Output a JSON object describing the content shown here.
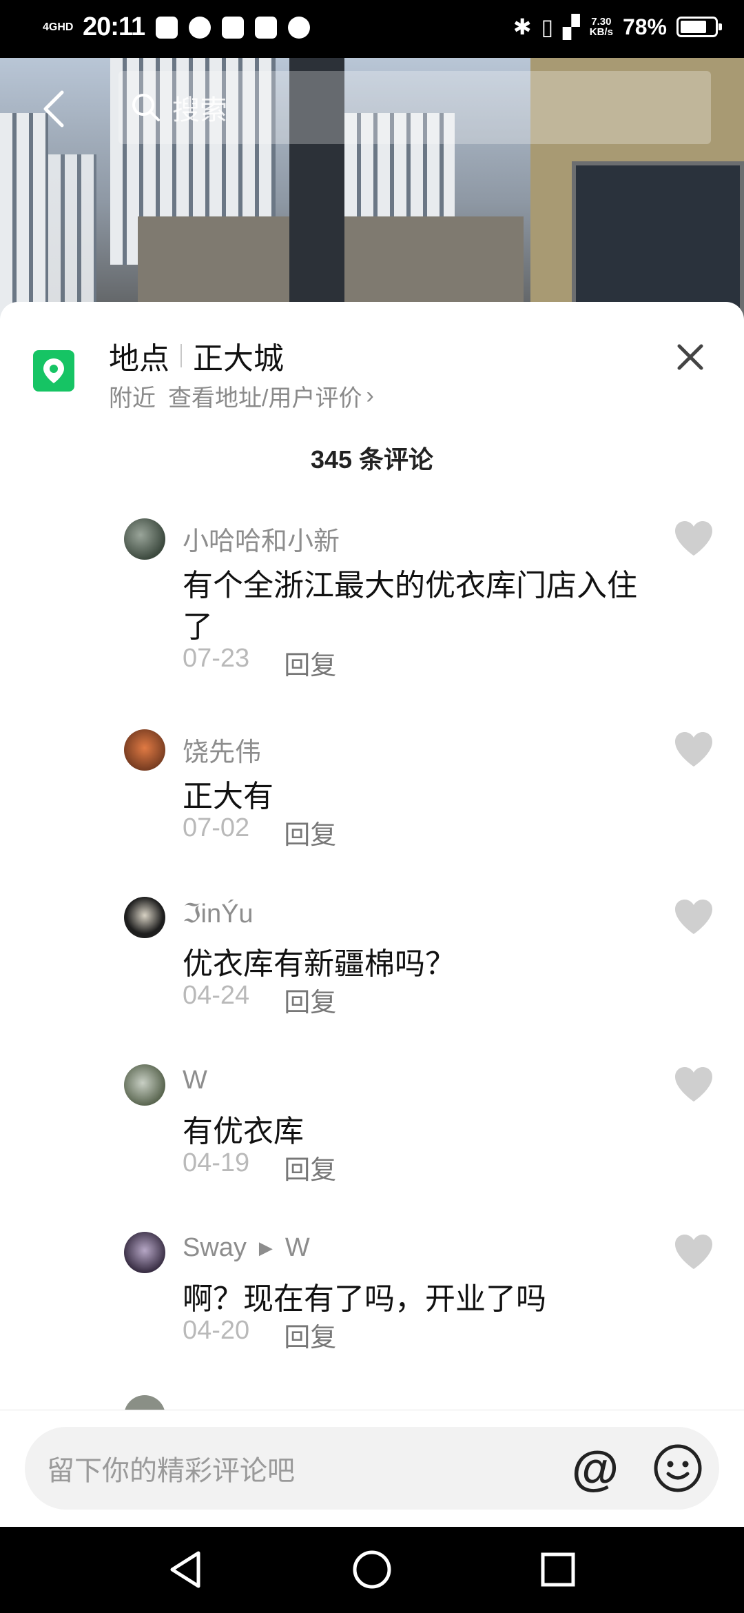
{
  "status_bar": {
    "network": "4GHD",
    "time": "20:11",
    "speed_value": "7.30",
    "speed_unit": "KB/s",
    "battery": "78%",
    "battery_level": 0.78
  },
  "header": {
    "search_placeholder": "搜索"
  },
  "location": {
    "label": "地点",
    "name": "正大城",
    "nearby": "附近",
    "link": "查看地址/用户评价",
    "chevron": "›"
  },
  "comments_count": "345 条评论",
  "comments": [
    {
      "name": "小哈哈和小新",
      "text": "有个全浙江最大的优衣库门店入住了",
      "date": "07-23",
      "reply": "回复"
    },
    {
      "name": "饶先伟",
      "text": "正大有",
      "date": "07-02",
      "reply": "回复"
    },
    {
      "name": "ℑinÝu",
      "text": "优衣库有新疆棉吗？",
      "date": "04-24",
      "reply": "回复"
    },
    {
      "name": "W",
      "text": "有优衣库",
      "date": "04-19",
      "reply": "回复"
    },
    {
      "name": "Sway",
      "reply_to": "W",
      "text": "啊？现在有了吗，开业了吗",
      "date": "04-20",
      "reply": "回复"
    }
  ],
  "input": {
    "placeholder": "留下你的精彩评论吧",
    "at_symbol": "@"
  },
  "icons": {
    "back": "chevron-left-icon",
    "search": "search-icon",
    "location": "location-pin-icon",
    "close": "close-icon",
    "like": "heart-icon",
    "emoji": "emoji-icon"
  },
  "colors": {
    "accent_green": "#16c464",
    "muted_text": "#8d8d8d",
    "heart": "#cfcfcf"
  }
}
